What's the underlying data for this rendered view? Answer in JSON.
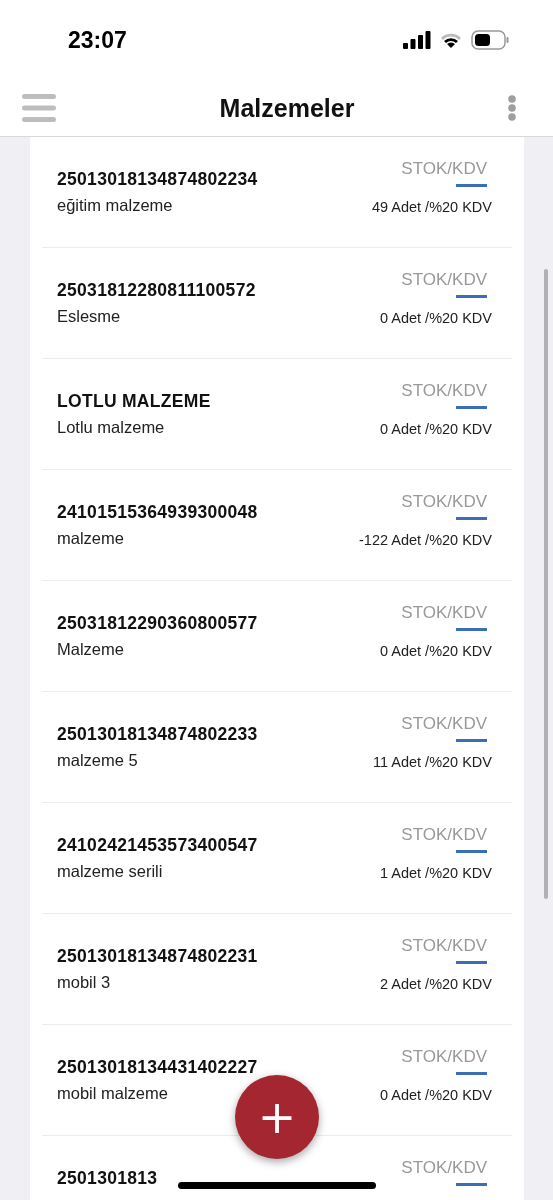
{
  "status_bar": {
    "time": "23:07"
  },
  "header": {
    "title": "Malzemeler"
  },
  "items": [
    {
      "code": "25013018134874802234",
      "name": "eğitim malzeme",
      "label": "STOK/KDV",
      "stock": "49 Adet /%20 KDV"
    },
    {
      "code": "25031812280811100572",
      "name": "Eslesme",
      "label": "STOK/KDV",
      "stock": "0 Adet /%20 KDV"
    },
    {
      "code": "LOTLU MALZEME",
      "name": "Lotlu malzeme",
      "label": "STOK/KDV",
      "stock": "0 Adet /%20 KDV"
    },
    {
      "code": "24101515364939300048",
      "name": "malzeme",
      "label": "STOK/KDV",
      "stock": "-122 Adet /%20 KDV"
    },
    {
      "code": "25031812290360800577",
      "name": "Malzeme",
      "label": "STOK/KDV",
      "stock": "0 Adet /%20 KDV"
    },
    {
      "code": "25013018134874802233",
      "name": "malzeme 5",
      "label": "STOK/KDV",
      "stock": "11 Adet /%20 KDV"
    },
    {
      "code": "24102421453573400547",
      "name": "malzeme serili",
      "label": "STOK/KDV",
      "stock": "1 Adet /%20 KDV"
    },
    {
      "code": "25013018134874802231",
      "name": "mobil 3",
      "label": "STOK/KDV",
      "stock": "2 Adet /%20 KDV"
    },
    {
      "code": "25013018134431402227",
      "name": "mobil malzeme",
      "label": "STOK/KDV",
      "stock": "0 Adet /%20 KDV"
    },
    {
      "code": "2501301813",
      "label": "STOK/KDV"
    }
  ],
  "fab": {
    "label": "+"
  }
}
